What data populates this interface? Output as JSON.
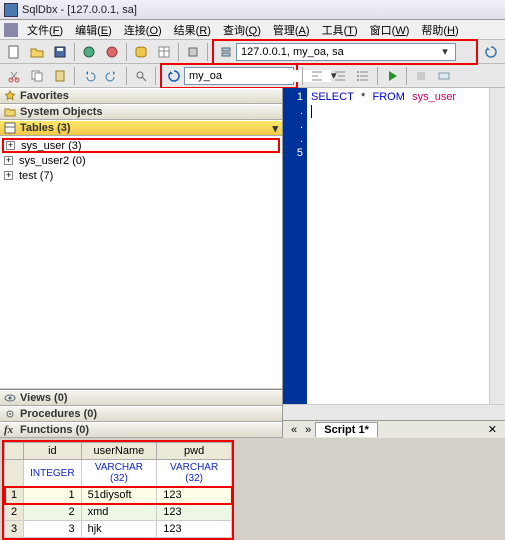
{
  "window": {
    "title": "SqlDbx - [127.0.0.1, sa]"
  },
  "menu": {
    "file": "文件",
    "file_k": "F",
    "edit": "编辑",
    "edit_k": "E",
    "connect": "连接",
    "connect_k": "O",
    "result": "结果",
    "result_k": "R",
    "query": "查询",
    "query_k": "Q",
    "manage": "管理",
    "manage_k": "A",
    "tool": "工具",
    "tool_k": "T",
    "window": "窗口",
    "window_k": "W",
    "help": "帮助",
    "help_k": "H"
  },
  "combo_server": {
    "value": "127.0.0.1, my_oa, sa"
  },
  "combo_db": {
    "value": "my_oa"
  },
  "panels": {
    "fav": "Favorites",
    "sys": "System Objects",
    "tables": "Tables (3)",
    "views": "Views (0)",
    "procs": "Procedures (0)",
    "funcs": "Functions (0)"
  },
  "tree": {
    "n0": "sys_user (3)",
    "n1": "sys_user2 (0)",
    "n2": "test (7)"
  },
  "sql": {
    "kw1": "SELECT",
    "star": "*",
    "kw2": "FROM",
    "tbl": "sys_user"
  },
  "gutter": {
    "l1": "1",
    "l2": ".",
    "l3": ".",
    "l4": ".",
    "l5": "5"
  },
  "tab": {
    "t1": "Script 1*"
  },
  "tabnav": {
    "prev": "«",
    "next": "»"
  },
  "result": {
    "headers": {
      "c0": "",
      "c1": "id",
      "c2": "userName",
      "c3": "pwd"
    },
    "types": {
      "c1": "INTEGER",
      "c2": "VARCHAR (32)",
      "c3": "VARCHAR (32)"
    },
    "rows": [
      {
        "n": "1",
        "id": "1",
        "user": "51diysoft",
        "pwd": "123"
      },
      {
        "n": "2",
        "id": "2",
        "user": "xmd",
        "pwd": "123"
      },
      {
        "n": "3",
        "id": "3",
        "user": "hjk",
        "pwd": "123"
      }
    ]
  },
  "chart_data": {
    "type": "table",
    "title": "sys_user rows",
    "columns": [
      "id",
      "userName",
      "pwd"
    ],
    "column_types": [
      "INTEGER",
      "VARCHAR (32)",
      "VARCHAR (32)"
    ],
    "rows": [
      [
        1,
        "51diysoft",
        "123"
      ],
      [
        2,
        "xmd",
        "123"
      ],
      [
        3,
        "hjk",
        "123"
      ]
    ]
  }
}
